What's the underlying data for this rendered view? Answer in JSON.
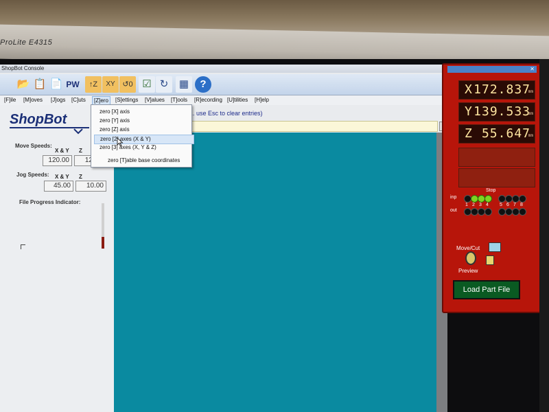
{
  "monitor": {
    "brand": "ProLite E4315"
  },
  "window": {
    "title": "ShopBot Console"
  },
  "toolbar": {
    "pw_label": "PW"
  },
  "menubar": {
    "items": [
      "[F]ile",
      "[M]oves",
      "[J]ogs",
      "[C]uts",
      "[Z]ero",
      "[S]ettings",
      "[V]alues",
      "[T]ools",
      "[R]ecording",
      "[U]tilities",
      "[H]elp"
    ]
  },
  "zero_menu": {
    "items": [
      "zero [X] axis",
      "zero [Y] axis",
      "zero [Z] axis",
      "zero [2] axes (X & Y)",
      "zero [3] axes (X, Y & Z)",
      "zero [T]able base coordinates"
    ],
    "highlighted_index": 3
  },
  "left_panel": {
    "logo_text": "ShopBot",
    "move_speeds": {
      "label": "Move Speeds:",
      "xy_header": "X & Y",
      "z_header": "Z",
      "xy_value": "120.00",
      "z_value": "12"
    },
    "jog_speeds": {
      "label": "Jog Speeds:",
      "xy_header": "X & Y",
      "z_header": "Z",
      "xy_value": "45.00",
      "z_value": "10.00"
    },
    "progress": {
      "label": "File Progress Indicator:"
    }
  },
  "main": {
    "hint": "... use Esc to clear entries)"
  },
  "dro": {
    "x": {
      "axis": "X",
      "value": "172.837",
      "unit": "mm"
    },
    "y": {
      "axis": "Y",
      "value": "139.533",
      "unit": "mm"
    },
    "z": {
      "axis": "Z",
      "value": "55.647",
      "unit": "mm"
    },
    "io": {
      "stop_label": "Stop",
      "inp_label": "inp",
      "out_label": "out",
      "numbers": [
        "1",
        "2",
        "3",
        "4",
        "5",
        "6",
        "7",
        "8"
      ],
      "inputs_on": [
        2,
        3,
        4
      ]
    },
    "move_cut_label": "Move/Cut",
    "preview_label": "Preview",
    "load_button": "Load Part File"
  },
  "colors": {
    "work_area": "#0a8aa0",
    "dro_panel": "#b7150a",
    "readout_text": "#ffe6a0",
    "load_button": "#0a5a22"
  }
}
